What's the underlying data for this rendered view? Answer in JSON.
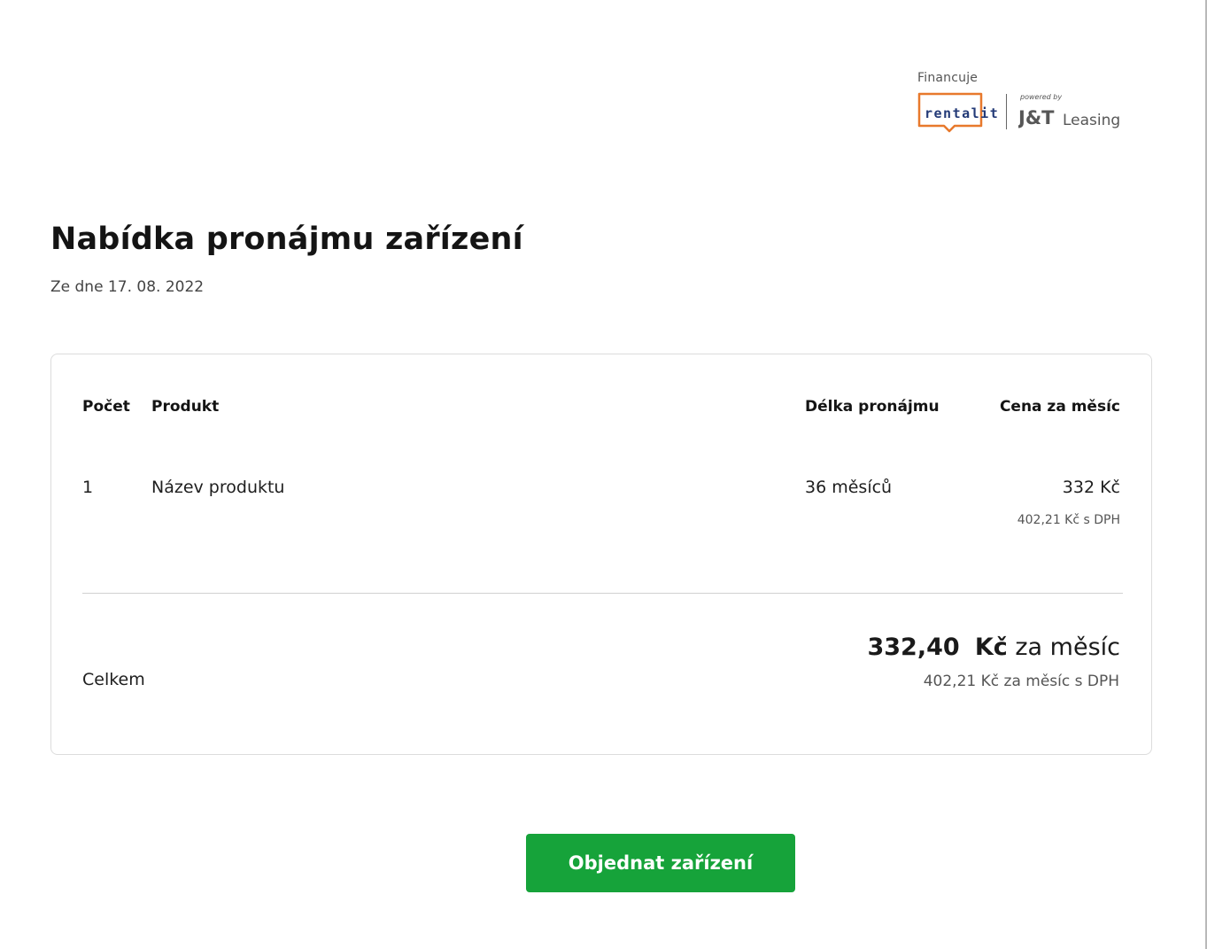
{
  "header": {
    "financing_label": "Financuje",
    "rentalit_logo_text": "rentalit",
    "powered_by_text": "powered by",
    "jt_logo_text": "J&T",
    "leasing_logo_text": "Leasing"
  },
  "page": {
    "title": "Nabídka pronájmu zařízení",
    "date_line": "Ze dne 17. 08. 2022"
  },
  "table": {
    "headers": {
      "count": "Počet",
      "product": "Produkt",
      "duration": "Délka pronájmu",
      "price": "Cena za měsíc"
    },
    "rows": [
      {
        "count": "1",
        "product": "Název produktu",
        "duration": "36 měsíců",
        "price": "332 Kč",
        "price_vat": "402,21 Kč s DPH"
      }
    ]
  },
  "total": {
    "label": "Celkem",
    "amount": "332,40",
    "currency": "Kč",
    "period": "za měsíc",
    "vat_line": "402,21 Kč za měsíc s DPH"
  },
  "actions": {
    "order_label": "Objednat zařízení"
  },
  "colors": {
    "accent_green": "#16a33a",
    "rentalit_orange": "#e8792c",
    "rentalit_navy": "#233a77"
  }
}
